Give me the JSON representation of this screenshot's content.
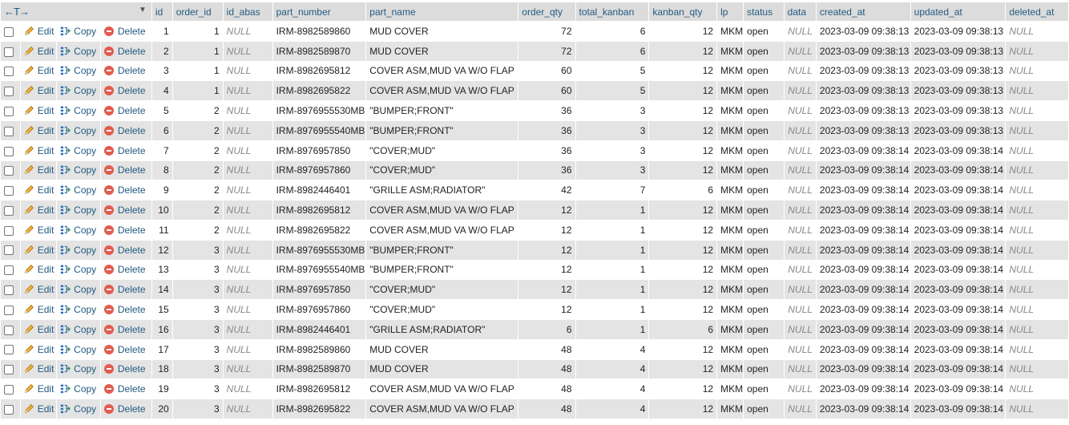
{
  "header": {
    "nav_arrows": "←T→",
    "sort_caret": "▼",
    "columns": [
      "id",
      "order_id",
      "id_abas",
      "part_number",
      "part_name",
      "order_qty",
      "total_kanban",
      "kanban_qty",
      "lp",
      "status",
      "data",
      "created_at",
      "updated_at",
      "deleted_at"
    ]
  },
  "actions": {
    "edit": "Edit",
    "copy": "Copy",
    "delete": "Delete"
  },
  "icons": {
    "edit": "pencil-icon",
    "copy": "copy-icon",
    "delete": "delete-icon"
  },
  "colors": {
    "link": "#235a81",
    "header_bg": "#dcdcdc",
    "row_alt": "#e4e4e4",
    "delete": "#e25b4e"
  },
  "rows": [
    {
      "id": "1",
      "order_id": "1",
      "id_abas": "NULL",
      "part_number": "IRM-8982589860",
      "part_name": "MUD COVER",
      "order_qty": "72",
      "total_kanban": "6",
      "kanban_qty": "12",
      "lp": "MKM",
      "status": "open",
      "data": "NULL",
      "created_at": "2023-03-09 09:38:13",
      "updated_at": "2023-03-09 09:38:13",
      "deleted_at": "NULL"
    },
    {
      "id": "2",
      "order_id": "1",
      "id_abas": "NULL",
      "part_number": "IRM-8982589870",
      "part_name": "MUD COVER",
      "order_qty": "72",
      "total_kanban": "6",
      "kanban_qty": "12",
      "lp": "MKM",
      "status": "open",
      "data": "NULL",
      "created_at": "2023-03-09 09:38:13",
      "updated_at": "2023-03-09 09:38:13",
      "deleted_at": "NULL"
    },
    {
      "id": "3",
      "order_id": "1",
      "id_abas": "NULL",
      "part_number": "IRM-8982695812",
      "part_name": "COVER ASM,MUD VA W/O FLAP",
      "order_qty": "60",
      "total_kanban": "5",
      "kanban_qty": "12",
      "lp": "MKM",
      "status": "open",
      "data": "NULL",
      "created_at": "2023-03-09 09:38:13",
      "updated_at": "2023-03-09 09:38:13",
      "deleted_at": "NULL"
    },
    {
      "id": "4",
      "order_id": "1",
      "id_abas": "NULL",
      "part_number": "IRM-8982695822",
      "part_name": "COVER ASM,MUD VA W/O FLAP",
      "order_qty": "60",
      "total_kanban": "5",
      "kanban_qty": "12",
      "lp": "MKM",
      "status": "open",
      "data": "NULL",
      "created_at": "2023-03-09 09:38:13",
      "updated_at": "2023-03-09 09:38:13",
      "deleted_at": "NULL"
    },
    {
      "id": "5",
      "order_id": "2",
      "id_abas": "NULL",
      "part_number": "IRM-8976955530MB",
      "part_name": "\"BUMPER;FRONT\"",
      "order_qty": "36",
      "total_kanban": "3",
      "kanban_qty": "12",
      "lp": "MKM",
      "status": "open",
      "data": "NULL",
      "created_at": "2023-03-09 09:38:13",
      "updated_at": "2023-03-09 09:38:13",
      "deleted_at": "NULL"
    },
    {
      "id": "6",
      "order_id": "2",
      "id_abas": "NULL",
      "part_number": "IRM-8976955540MB",
      "part_name": "\"BUMPER;FRONT\"",
      "order_qty": "36",
      "total_kanban": "3",
      "kanban_qty": "12",
      "lp": "MKM",
      "status": "open",
      "data": "NULL",
      "created_at": "2023-03-09 09:38:13",
      "updated_at": "2023-03-09 09:38:13",
      "deleted_at": "NULL"
    },
    {
      "id": "7",
      "order_id": "2",
      "id_abas": "NULL",
      "part_number": "IRM-8976957850",
      "part_name": "\"COVER;MUD\"",
      "order_qty": "36",
      "total_kanban": "3",
      "kanban_qty": "12",
      "lp": "MKM",
      "status": "open",
      "data": "NULL",
      "created_at": "2023-03-09 09:38:14",
      "updated_at": "2023-03-09 09:38:14",
      "deleted_at": "NULL"
    },
    {
      "id": "8",
      "order_id": "2",
      "id_abas": "NULL",
      "part_number": "IRM-8976957860",
      "part_name": "\"COVER;MUD\"",
      "order_qty": "36",
      "total_kanban": "3",
      "kanban_qty": "12",
      "lp": "MKM",
      "status": "open",
      "data": "NULL",
      "created_at": "2023-03-09 09:38:14",
      "updated_at": "2023-03-09 09:38:14",
      "deleted_at": "NULL"
    },
    {
      "id": "9",
      "order_id": "2",
      "id_abas": "NULL",
      "part_number": "IRM-8982446401",
      "part_name": "\"GRILLE ASM;RADIATOR\"",
      "order_qty": "42",
      "total_kanban": "7",
      "kanban_qty": "6",
      "lp": "MKM",
      "status": "open",
      "data": "NULL",
      "created_at": "2023-03-09 09:38:14",
      "updated_at": "2023-03-09 09:38:14",
      "deleted_at": "NULL"
    },
    {
      "id": "10",
      "order_id": "2",
      "id_abas": "NULL",
      "part_number": "IRM-8982695812",
      "part_name": "COVER ASM,MUD VA W/O FLAP",
      "order_qty": "12",
      "total_kanban": "1",
      "kanban_qty": "12",
      "lp": "MKM",
      "status": "open",
      "data": "NULL",
      "created_at": "2023-03-09 09:38:14",
      "updated_at": "2023-03-09 09:38:14",
      "deleted_at": "NULL"
    },
    {
      "id": "11",
      "order_id": "2",
      "id_abas": "NULL",
      "part_number": "IRM-8982695822",
      "part_name": "COVER ASM,MUD VA W/O FLAP",
      "order_qty": "12",
      "total_kanban": "1",
      "kanban_qty": "12",
      "lp": "MKM",
      "status": "open",
      "data": "NULL",
      "created_at": "2023-03-09 09:38:14",
      "updated_at": "2023-03-09 09:38:14",
      "deleted_at": "NULL"
    },
    {
      "id": "12",
      "order_id": "3",
      "id_abas": "NULL",
      "part_number": "IRM-8976955530MB",
      "part_name": "\"BUMPER;FRONT\"",
      "order_qty": "12",
      "total_kanban": "1",
      "kanban_qty": "12",
      "lp": "MKM",
      "status": "open",
      "data": "NULL",
      "created_at": "2023-03-09 09:38:14",
      "updated_at": "2023-03-09 09:38:14",
      "deleted_at": "NULL"
    },
    {
      "id": "13",
      "order_id": "3",
      "id_abas": "NULL",
      "part_number": "IRM-8976955540MB",
      "part_name": "\"BUMPER;FRONT\"",
      "order_qty": "12",
      "total_kanban": "1",
      "kanban_qty": "12",
      "lp": "MKM",
      "status": "open",
      "data": "NULL",
      "created_at": "2023-03-09 09:38:14",
      "updated_at": "2023-03-09 09:38:14",
      "deleted_at": "NULL"
    },
    {
      "id": "14",
      "order_id": "3",
      "id_abas": "NULL",
      "part_number": "IRM-8976957850",
      "part_name": "\"COVER;MUD\"",
      "order_qty": "12",
      "total_kanban": "1",
      "kanban_qty": "12",
      "lp": "MKM",
      "status": "open",
      "data": "NULL",
      "created_at": "2023-03-09 09:38:14",
      "updated_at": "2023-03-09 09:38:14",
      "deleted_at": "NULL"
    },
    {
      "id": "15",
      "order_id": "3",
      "id_abas": "NULL",
      "part_number": "IRM-8976957860",
      "part_name": "\"COVER;MUD\"",
      "order_qty": "12",
      "total_kanban": "1",
      "kanban_qty": "12",
      "lp": "MKM",
      "status": "open",
      "data": "NULL",
      "created_at": "2023-03-09 09:38:14",
      "updated_at": "2023-03-09 09:38:14",
      "deleted_at": "NULL"
    },
    {
      "id": "16",
      "order_id": "3",
      "id_abas": "NULL",
      "part_number": "IRM-8982446401",
      "part_name": "\"GRILLE ASM;RADIATOR\"",
      "order_qty": "6",
      "total_kanban": "1",
      "kanban_qty": "6",
      "lp": "MKM",
      "status": "open",
      "data": "NULL",
      "created_at": "2023-03-09 09:38:14",
      "updated_at": "2023-03-09 09:38:14",
      "deleted_at": "NULL"
    },
    {
      "id": "17",
      "order_id": "3",
      "id_abas": "NULL",
      "part_number": "IRM-8982589860",
      "part_name": "MUD COVER",
      "order_qty": "48",
      "total_kanban": "4",
      "kanban_qty": "12",
      "lp": "MKM",
      "status": "open",
      "data": "NULL",
      "created_at": "2023-03-09 09:38:14",
      "updated_at": "2023-03-09 09:38:14",
      "deleted_at": "NULL"
    },
    {
      "id": "18",
      "order_id": "3",
      "id_abas": "NULL",
      "part_number": "IRM-8982589870",
      "part_name": "MUD COVER",
      "order_qty": "48",
      "total_kanban": "4",
      "kanban_qty": "12",
      "lp": "MKM",
      "status": "open",
      "data": "NULL",
      "created_at": "2023-03-09 09:38:14",
      "updated_at": "2023-03-09 09:38:14",
      "deleted_at": "NULL"
    },
    {
      "id": "19",
      "order_id": "3",
      "id_abas": "NULL",
      "part_number": "IRM-8982695812",
      "part_name": "COVER ASM,MUD VA W/O FLAP",
      "order_qty": "48",
      "total_kanban": "4",
      "kanban_qty": "12",
      "lp": "MKM",
      "status": "open",
      "data": "NULL",
      "created_at": "2023-03-09 09:38:14",
      "updated_at": "2023-03-09 09:38:14",
      "deleted_at": "NULL"
    },
    {
      "id": "20",
      "order_id": "3",
      "id_abas": "NULL",
      "part_number": "IRM-8982695822",
      "part_name": "COVER ASM,MUD VA W/O FLAP",
      "order_qty": "48",
      "total_kanban": "4",
      "kanban_qty": "12",
      "lp": "MKM",
      "status": "open",
      "data": "NULL",
      "created_at": "2023-03-09 09:38:14",
      "updated_at": "2023-03-09 09:38:14",
      "deleted_at": "NULL"
    }
  ]
}
